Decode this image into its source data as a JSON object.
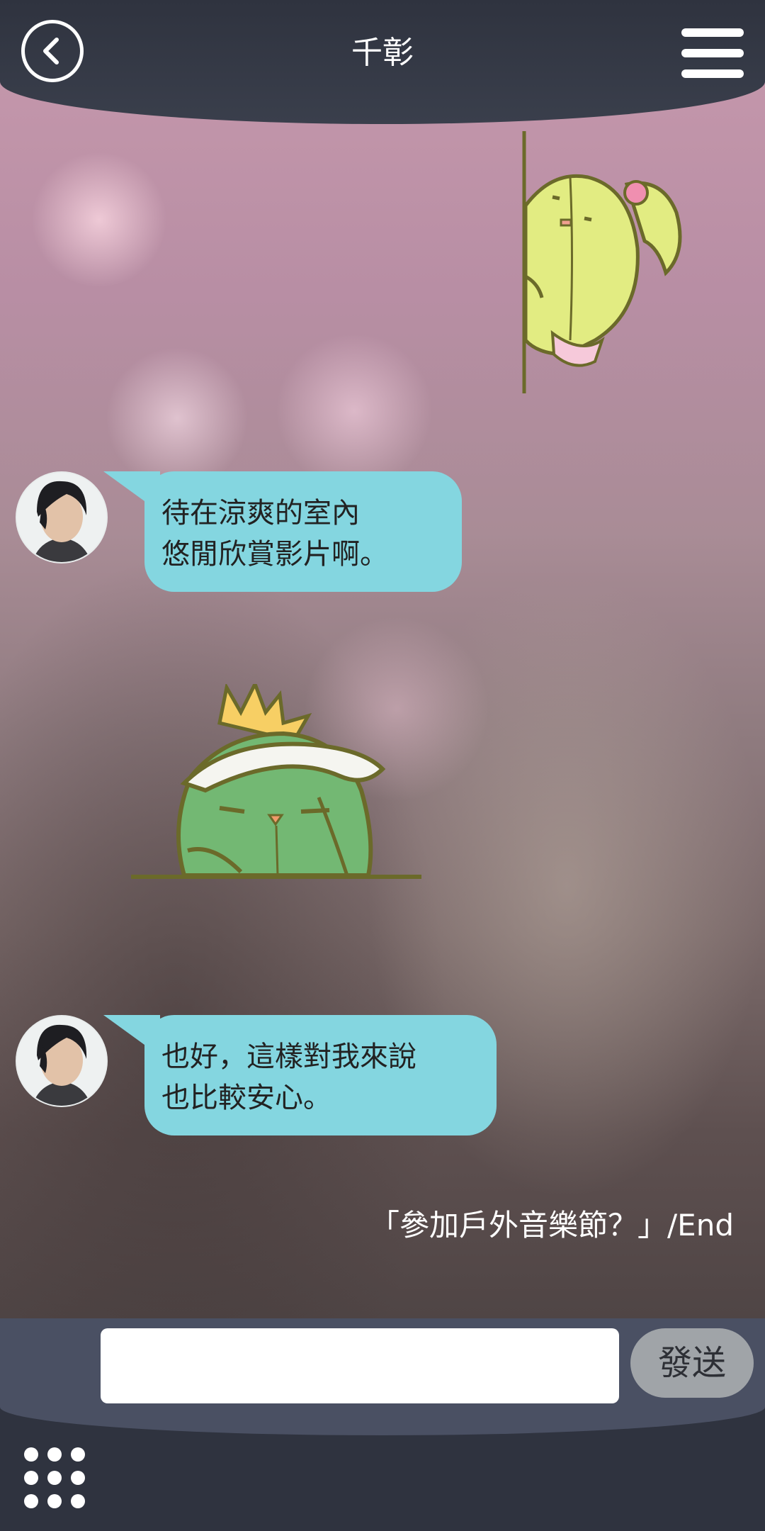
{
  "header": {
    "title": "千彰"
  },
  "messages": [
    {
      "sender": "avatar",
      "lines": [
        "待在涼爽的室內",
        "悠閒欣賞影片啊。"
      ]
    },
    {
      "sender": "avatar",
      "lines": [
        "也好，這樣對我來說",
        "也比較安心。"
      ]
    }
  ],
  "end_note": "「參加戶外音樂節？」/End",
  "composer": {
    "input_value": "",
    "send_label": "發送"
  },
  "icons": {
    "back": "chevron-left-icon",
    "menu": "hamburger-menu-icon",
    "grid": "grid-dots-icon"
  },
  "colors": {
    "bubble": "#84d6e0",
    "header": "#2f333f",
    "send_button": "#a0a4a8"
  }
}
